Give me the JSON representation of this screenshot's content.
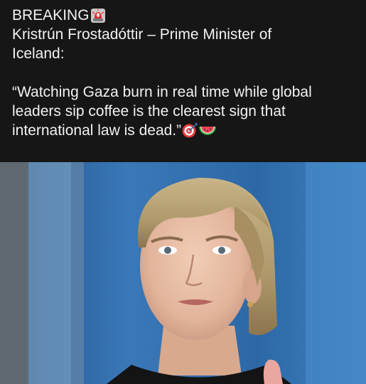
{
  "post": {
    "headline": "BREAKING",
    "headline_icon": "police-light-icon",
    "attribution_line1": "Kristrún Frostadóttir – Prime Minister of",
    "attribution_line2": "Iceland:",
    "quote_line1": "“Watching Gaza burn in real time while global",
    "quote_line2": "leaders sip coffee is the clearest sign that",
    "quote_line3": "international law is dead.”",
    "quote_icons": [
      "direct-hit-icon",
      "watermelon-icon"
    ]
  },
  "colors": {
    "background": "#161616",
    "text": "#f2f2f2",
    "photo_backdrop": "#2f6aa6"
  }
}
